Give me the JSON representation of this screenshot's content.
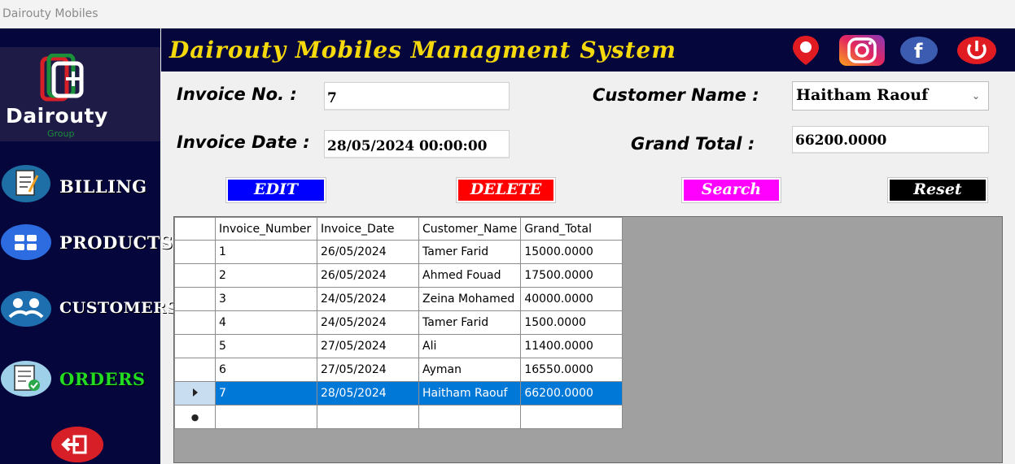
{
  "window": {
    "title": "Dairouty Mobiles"
  },
  "sidebar": {
    "logo_text": "Dairouty",
    "logo_sub": "Group",
    "items": [
      {
        "label": "BILLING",
        "icon": "billing-clipboard-icon"
      },
      {
        "label": "PRODUCTS",
        "icon": "grid-tiles-icon"
      },
      {
        "label": "CUSTOMERS",
        "icon": "handshake-icon"
      },
      {
        "label": "ORDERS",
        "icon": "orders-checklist-icon",
        "active": true
      }
    ],
    "exit_icon": "exit-icon"
  },
  "header": {
    "title": "Dairouty Mobiles Managment System",
    "icons": [
      "location-pin-icon",
      "instagram-icon",
      "facebook-icon",
      "power-icon"
    ]
  },
  "form": {
    "invoice_no_label": "Invoice No.  :",
    "invoice_no_value": "7",
    "invoice_date_label": "Invoice Date :",
    "invoice_date_value": "28/05/2024 00:00:00",
    "customer_name_label": "Customer Name :",
    "customer_name_value": "Haitham Raouf",
    "grand_total_label": "Grand Total :",
    "grand_total_value": "66200.0000"
  },
  "buttons": {
    "edit": "EDIT",
    "delete": "DELETE",
    "search": "Search",
    "reset": "Reset"
  },
  "colors": {
    "sidebar_bg": "#05063b",
    "header_title": "#f5d90a",
    "edit_bg": "#0000ff",
    "delete_bg": "#ff0000",
    "search_bg": "#ff00ff",
    "reset_bg": "#000000",
    "selected_row": "#0078d7",
    "active_nav": "#22dd22"
  },
  "grid": {
    "columns": [
      "Invoice_Number",
      "Invoice_Date",
      "Customer_Name",
      "Grand_Total"
    ],
    "rows": [
      [
        "1",
        "26/05/2024",
        "Tamer Farid",
        "15000.0000"
      ],
      [
        "2",
        "26/05/2024",
        "Ahmed Fouad",
        "17500.0000"
      ],
      [
        "3",
        "24/05/2024",
        "Zeina Mohamed",
        "40000.0000"
      ],
      [
        "4",
        "24/05/2024",
        "Tamer Farid",
        "1500.0000"
      ],
      [
        "5",
        "27/05/2024",
        "Ali",
        "11400.0000"
      ],
      [
        "6",
        "27/05/2024",
        "Ayman",
        "16550.0000"
      ],
      [
        "7",
        "28/05/2024",
        "Haitham Raouf",
        "66200.0000"
      ]
    ],
    "selected_row_index": 6
  }
}
